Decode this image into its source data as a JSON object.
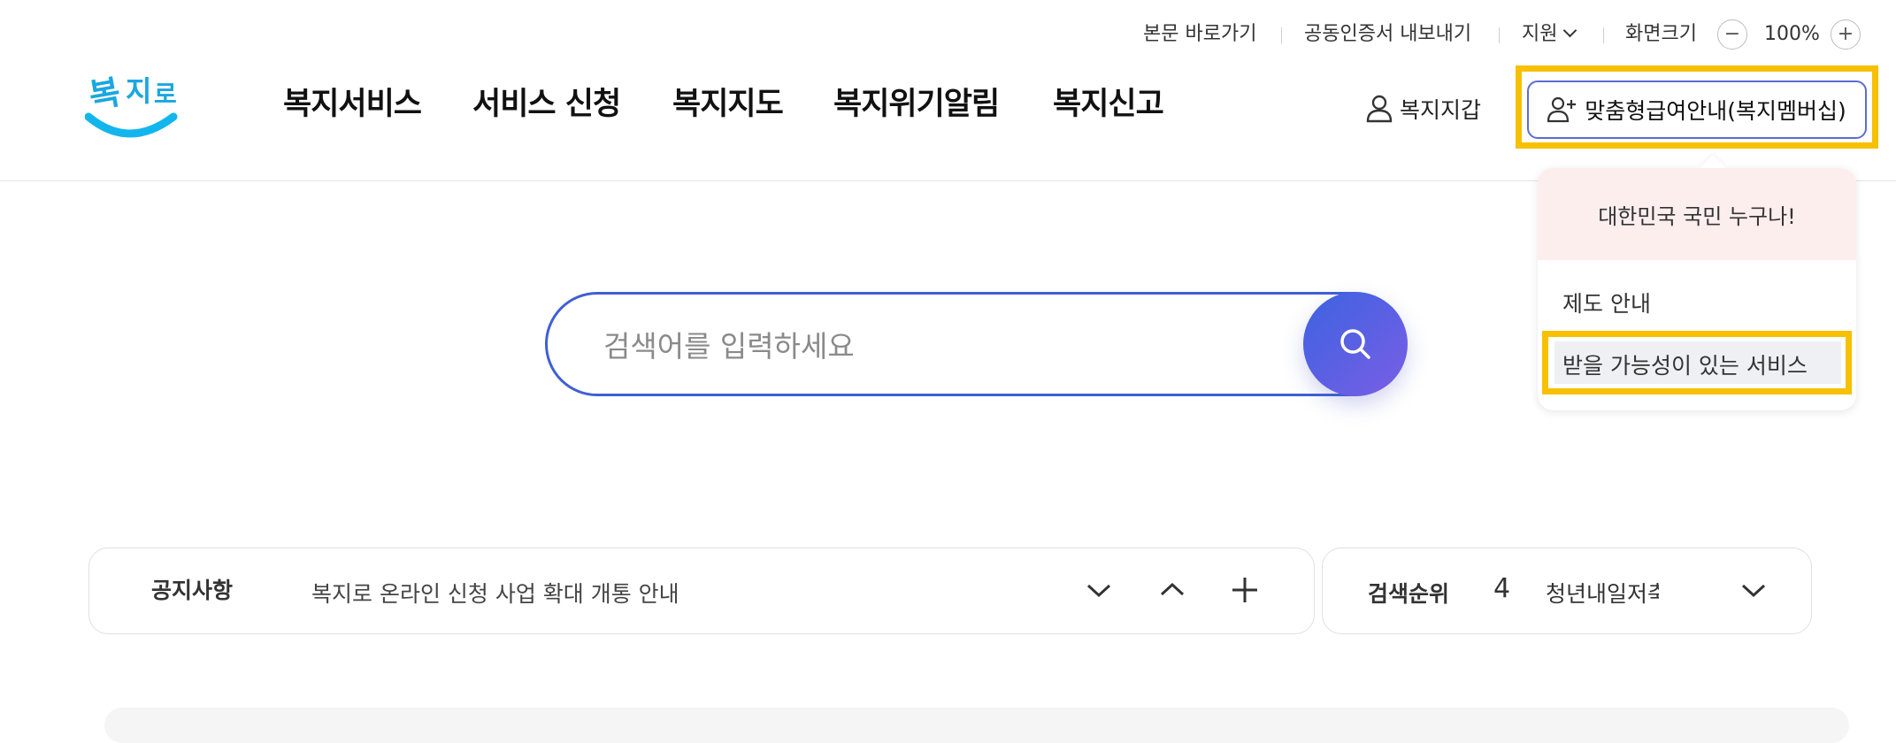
{
  "util": {
    "skip_link": "본문 바로가기",
    "cert_export": "공동인증서 내보내기",
    "support": "지원",
    "zoom_label": "화면크기",
    "zoom_value": "100%",
    "zoom_out_symbol": "−",
    "zoom_in_symbol": "+"
  },
  "logo": {
    "text": "복지로",
    "icon": "bokjiro-logo"
  },
  "gnb": {
    "items": [
      "복지서비스",
      "서비스 신청",
      "복지지도",
      "복지위기알림",
      "복지신고"
    ]
  },
  "header": {
    "wallet_label": "복지지갑",
    "member_label": "맞춤형급여안내(복지멤버십)"
  },
  "dropdown": {
    "headline": "대한민국 국민 누구나!",
    "items": [
      "제도 안내",
      "받을 가능성이 있는 서비스"
    ]
  },
  "search": {
    "placeholder": "검색어를 입력하세요"
  },
  "notice": {
    "title": "공지사항",
    "text": "복지로 온라인 신청 사업 확대 개통 안내"
  },
  "rank": {
    "title": "검색순위",
    "number": "4",
    "text": "청년내일저축계좌"
  },
  "colors": {
    "highlight": "#f7c000",
    "accent": "#3f5fd6",
    "search_gradient_start": "#3c63e0",
    "search_gradient_end": "#7a5ee6",
    "dropdown_head_bg": "#fdeeee"
  }
}
